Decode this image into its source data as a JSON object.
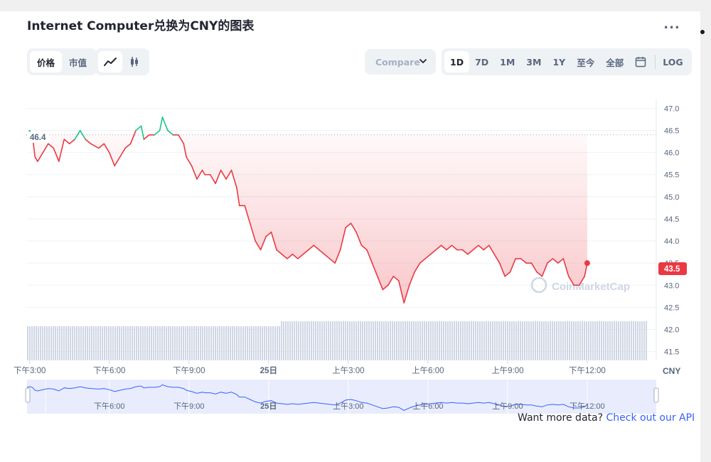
{
  "title": "Internet Computer兑换为CNY的图表",
  "more_label": "...",
  "type_tabs": [
    {
      "label": "价格",
      "active": true
    },
    {
      "label": "市值",
      "active": false
    }
  ],
  "chart_type_icons": [
    "line-chart-icon",
    "candlestick-icon"
  ],
  "compare_label": "Compare",
  "range_tabs": [
    {
      "label": "1D",
      "active": true
    },
    {
      "label": "7D",
      "active": false
    },
    {
      "label": "1M",
      "active": false
    },
    {
      "label": "3M",
      "active": false
    },
    {
      "label": "1Y",
      "active": false
    },
    {
      "label": "至今",
      "active": false
    },
    {
      "label": "全部",
      "active": false
    }
  ],
  "calendar_icon": "calendar-icon",
  "log_label": "LOG",
  "watermark": "CoinMarketCap",
  "currency_label": "CNY",
  "api": {
    "prefix": "Want more data?",
    "link": "Check out our API"
  },
  "colors": {
    "up": "#16c784",
    "down": "#ea3943",
    "accent": "#3861fb",
    "volume": "#cfd6e4",
    "navigator_fill": "#e8ecfd",
    "navigator_line": "#3861fb"
  },
  "chart_data": {
    "type": "line",
    "title": "Internet Computer兑换为CNY的图表",
    "xlabel": "",
    "ylabel": "",
    "ylim": [
      41.3,
      47.2
    ],
    "y_ticks": [
      "41.5",
      "42.0",
      "42.5",
      "43.0",
      "43.5",
      "44.0",
      "44.5",
      "45.0",
      "45.5",
      "46.0",
      "46.5",
      "47.0"
    ],
    "x_ticks": [
      "下午3:00",
      "下午6:00",
      "下午9:00",
      "25日",
      "上午3:00",
      "上午6:00",
      "上午9:00",
      "下午12:00"
    ],
    "nav_ticks": [
      "下午6:00",
      "下午9:00",
      "25日",
      "上午3:00",
      "上午6:00",
      "上午9:00",
      "下午12:00"
    ],
    "x_range_hours": [
      14.9,
      38.6
    ],
    "open_price": 46.4,
    "open_label": "46.4",
    "last_price": 43.5,
    "last_label": "43.5",
    "grid": true,
    "legend": "none",
    "series": [
      {
        "values": [
          [
            14.9,
            46.4
          ],
          [
            15.0,
            46.5
          ],
          [
            15.1,
            46.4
          ],
          [
            15.2,
            45.9
          ],
          [
            15.3,
            45.8
          ],
          [
            15.5,
            46.0
          ],
          [
            15.7,
            46.2
          ],
          [
            15.9,
            46.1
          ],
          [
            16.1,
            45.8
          ],
          [
            16.3,
            46.3
          ],
          [
            16.5,
            46.2
          ],
          [
            16.7,
            46.3
          ],
          [
            16.9,
            46.5
          ],
          [
            17.1,
            46.3
          ],
          [
            17.3,
            46.2
          ],
          [
            17.6,
            46.1
          ],
          [
            17.8,
            46.2
          ],
          [
            18.0,
            46.0
          ],
          [
            18.2,
            45.7
          ],
          [
            18.4,
            45.9
          ],
          [
            18.6,
            46.1
          ],
          [
            18.8,
            46.2
          ],
          [
            19.0,
            46.5
          ],
          [
            19.2,
            46.6
          ],
          [
            19.3,
            46.3
          ],
          [
            19.5,
            46.4
          ],
          [
            19.7,
            46.4
          ],
          [
            19.9,
            46.5
          ],
          [
            20.0,
            46.8
          ],
          [
            20.2,
            46.5
          ],
          [
            20.4,
            46.4
          ],
          [
            20.6,
            46.4
          ],
          [
            20.8,
            46.2
          ],
          [
            20.9,
            45.9
          ],
          [
            21.1,
            45.7
          ],
          [
            21.3,
            45.4
          ],
          [
            21.5,
            45.6
          ],
          [
            21.6,
            45.5
          ],
          [
            21.8,
            45.5
          ],
          [
            22.0,
            45.3
          ],
          [
            22.2,
            45.6
          ],
          [
            22.4,
            45.4
          ],
          [
            22.6,
            45.6
          ],
          [
            22.8,
            45.2
          ],
          [
            22.9,
            44.8
          ],
          [
            23.1,
            44.8
          ],
          [
            23.3,
            44.4
          ],
          [
            23.5,
            44.0
          ],
          [
            23.7,
            43.8
          ],
          [
            23.9,
            44.1
          ],
          [
            24.1,
            44.2
          ],
          [
            24.3,
            43.8
          ],
          [
            24.5,
            43.7
          ],
          [
            24.7,
            43.6
          ],
          [
            24.9,
            43.7
          ],
          [
            25.1,
            43.6
          ],
          [
            25.3,
            43.7
          ],
          [
            25.5,
            43.8
          ],
          [
            25.7,
            43.9
          ],
          [
            25.9,
            43.8
          ],
          [
            26.1,
            43.7
          ],
          [
            26.3,
            43.6
          ],
          [
            26.5,
            43.5
          ],
          [
            26.7,
            43.8
          ],
          [
            26.9,
            44.3
          ],
          [
            27.1,
            44.4
          ],
          [
            27.3,
            44.2
          ],
          [
            27.5,
            43.9
          ],
          [
            27.7,
            43.8
          ],
          [
            27.9,
            43.5
          ],
          [
            28.1,
            43.2
          ],
          [
            28.3,
            42.9
          ],
          [
            28.5,
            43.0
          ],
          [
            28.7,
            43.2
          ],
          [
            28.9,
            43.1
          ],
          [
            29.1,
            42.6
          ],
          [
            29.3,
            43.0
          ],
          [
            29.5,
            43.3
          ],
          [
            29.7,
            43.5
          ],
          [
            29.9,
            43.6
          ],
          [
            30.1,
            43.7
          ],
          [
            30.3,
            43.8
          ],
          [
            30.5,
            43.9
          ],
          [
            30.7,
            43.8
          ],
          [
            30.9,
            43.9
          ],
          [
            31.1,
            43.8
          ],
          [
            31.3,
            43.8
          ],
          [
            31.5,
            43.7
          ],
          [
            31.7,
            43.8
          ],
          [
            31.9,
            43.9
          ],
          [
            32.1,
            43.8
          ],
          [
            32.3,
            43.9
          ],
          [
            32.5,
            43.7
          ],
          [
            32.7,
            43.5
          ],
          [
            32.9,
            43.2
          ],
          [
            33.1,
            43.3
          ],
          [
            33.3,
            43.6
          ],
          [
            33.5,
            43.6
          ],
          [
            33.7,
            43.5
          ],
          [
            33.9,
            43.5
          ],
          [
            34.1,
            43.3
          ],
          [
            34.3,
            43.2
          ],
          [
            34.5,
            43.5
          ],
          [
            34.7,
            43.6
          ],
          [
            34.9,
            43.5
          ],
          [
            35.1,
            43.6
          ],
          [
            35.3,
            43.2
          ],
          [
            35.5,
            43.0
          ],
          [
            35.7,
            43.0
          ],
          [
            35.9,
            43.2
          ],
          [
            36.0,
            43.5
          ]
        ]
      }
    ],
    "volume_note": "volume bars shown along bottom"
  }
}
